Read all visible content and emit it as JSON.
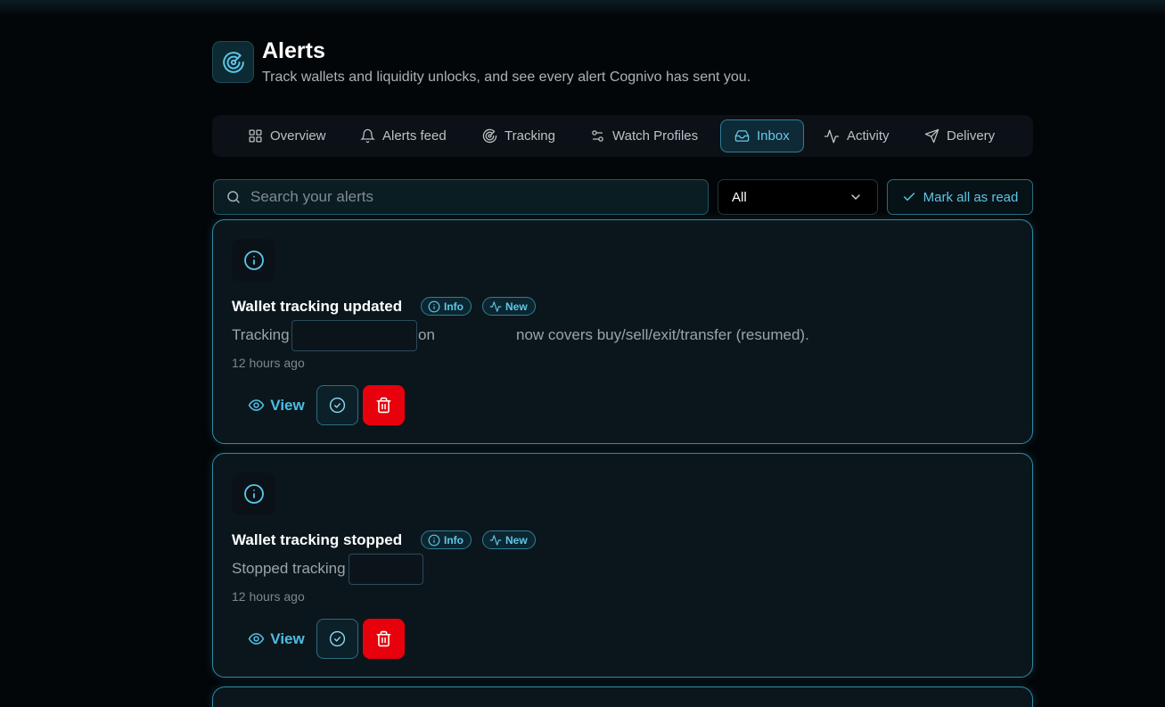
{
  "header": {
    "title": "Alerts",
    "subtitle": "Track wallets and liquidity unlocks, and see every alert Cognivo has sent you.",
    "logo_icon": "radar-icon"
  },
  "tabs": [
    {
      "label": "Overview",
      "icon": "grid-icon",
      "active": false
    },
    {
      "label": "Alerts feed",
      "icon": "bell-icon",
      "active": false
    },
    {
      "label": "Tracking",
      "icon": "target-icon",
      "active": false
    },
    {
      "label": "Watch Profiles",
      "icon": "sliders-icon",
      "active": false
    },
    {
      "label": "Inbox",
      "icon": "inbox-icon",
      "active": true
    },
    {
      "label": "Activity",
      "icon": "activity-icon",
      "active": false
    },
    {
      "label": "Delivery",
      "icon": "send-icon",
      "active": false
    }
  ],
  "toolbar": {
    "search_placeholder": "Search your alerts",
    "filter_value": "All",
    "mark_all_label": "Mark all as read"
  },
  "alerts": [
    {
      "title": "Wallet tracking updated",
      "badge_info": "Info",
      "badge_new": "New",
      "message_start": "Tracking",
      "message_mid": "on",
      "message_end": "now covers buy/sell/exit/transfer (resumed).",
      "time": "12 hours ago",
      "view_label": "View"
    },
    {
      "title": "Wallet tracking stopped",
      "badge_info": "Info",
      "badge_new": "New",
      "message_start": "Stopped tracking",
      "time": "12 hours ago",
      "view_label": "View"
    }
  ],
  "colors": {
    "accent": "#4fbce2",
    "card_border": "#2f8aa8",
    "delete": "#e8000d",
    "background": "#030608"
  }
}
